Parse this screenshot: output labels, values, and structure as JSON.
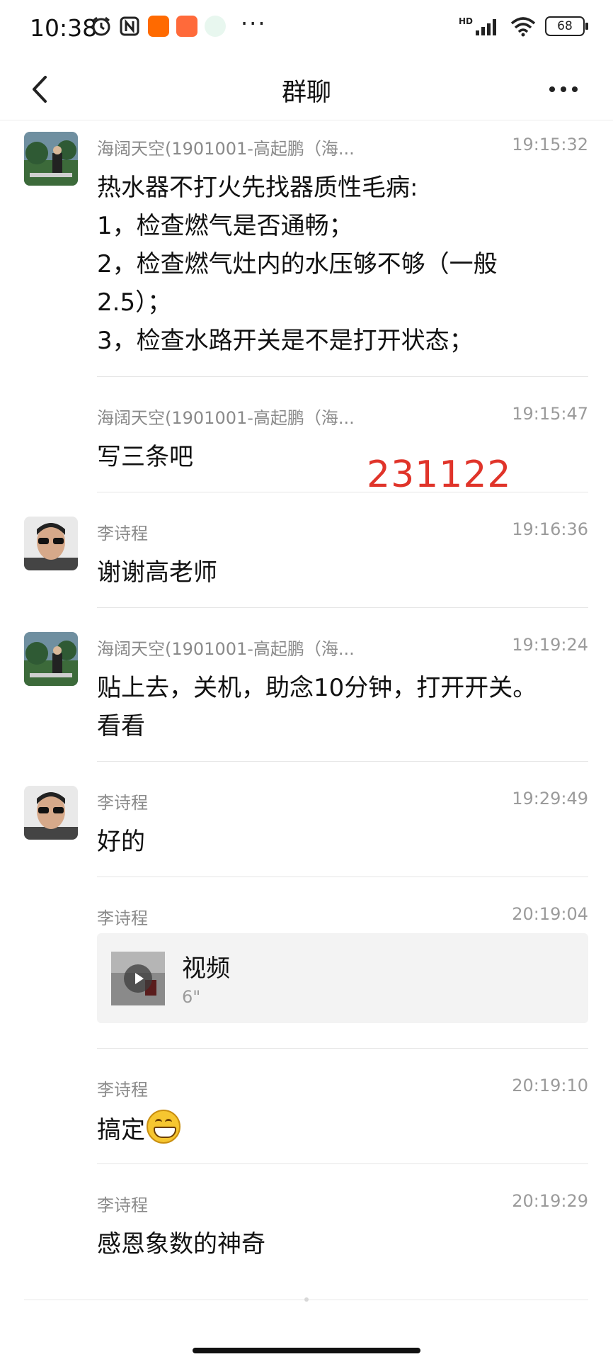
{
  "status_bar": {
    "time": "10:38",
    "icons": [
      "alarm-icon",
      "nfc-icon",
      "mi-app-icon",
      "shop-app-icon",
      "browser-app-icon"
    ],
    "more": "···",
    "network": "HD",
    "battery": "68"
  },
  "header": {
    "title": "群聊",
    "back_icon": "chevron-left-icon",
    "more_icon": "more-dots-icon"
  },
  "messages": [
    {
      "sender": "海阔天空(1901001-高起鹏（海...",
      "time": "19:15:32",
      "lines": [
        "热水器不打火先找器质性毛病:",
        "1，检查燃气是否通畅；",
        "2，检查燃气灶内的水压够不够（一般",
        "2.5）；",
        "3，检查水路开关是不是打开状态；"
      ]
    },
    {
      "sender": "海阔天空(1901001-高起鹏（海...",
      "time": "19:15:47",
      "lines": [
        "写三条吧"
      ]
    },
    {
      "sender": "李诗程",
      "time": "19:16:36",
      "lines": [
        "谢谢高老师"
      ]
    },
    {
      "sender": "海阔天空(1901001-高起鹏（海...",
      "time": "19:19:24",
      "lines": [
        "贴上去，关机，助念10分钟，打开开关。",
        "看看"
      ]
    },
    {
      "sender": "李诗程",
      "time": "19:29:49",
      "lines": [
        "好的"
      ]
    },
    {
      "sender": "李诗程",
      "time": "20:19:04",
      "video": {
        "title": "视频",
        "duration": "6\""
      }
    },
    {
      "sender": "李诗程",
      "time": "20:19:10",
      "lines": [
        "搞定"
      ],
      "emoji": "grinning-face-emoji"
    },
    {
      "sender": "李诗程",
      "time": "20:19:29",
      "lines": [
        "感恩象数的神奇"
      ]
    }
  ],
  "overlay_stamp": "231122",
  "colors": {
    "stamp": "#e0342a",
    "meta_text": "#8a8a8a",
    "separator": "#e6e6e6"
  }
}
